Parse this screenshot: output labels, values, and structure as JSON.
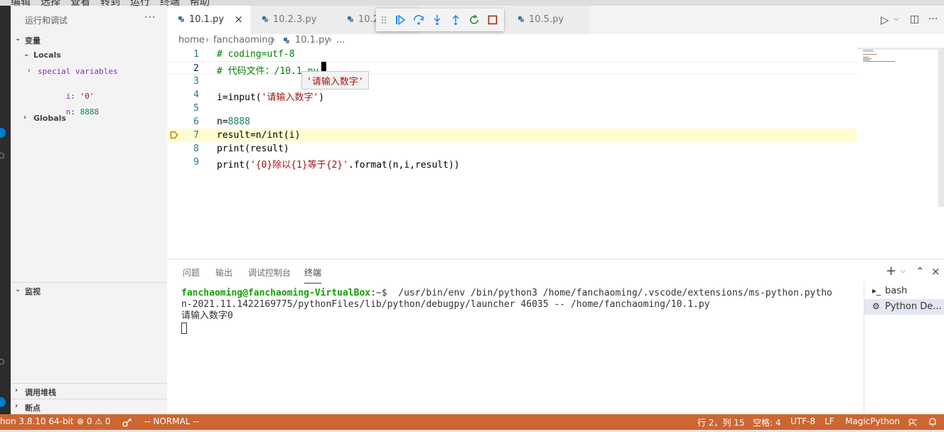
{
  "menubar": {
    "items": [
      "编辑",
      "选择",
      "查看",
      "转到",
      "运行",
      "终端",
      "帮助"
    ]
  },
  "sidebar": {
    "title": "运行和调试",
    "more": "···",
    "variables_label": "变量",
    "locals_label": "Locals",
    "special_variables": "special variables",
    "vars": [
      {
        "name": "i",
        "sep": ": ",
        "value": "'0'"
      },
      {
        "name": "n",
        "sep": ": ",
        "value": "8888"
      }
    ],
    "globals_label": "Globals",
    "watch_label": "监视",
    "callstack_label": "调用堆栈",
    "breakpoints_label": "断点"
  },
  "tabs": [
    {
      "label": "10.1.py",
      "active": true
    },
    {
      "label": "10.2.3.py",
      "active": false
    },
    {
      "label": "10.2",
      "active": false
    },
    {
      "label": "10.5.py",
      "active": false
    }
  ],
  "tab_close": "×",
  "toolbar_right": {
    "run": "▷",
    "run_dropdown": "⌵",
    "split": "◫",
    "more": "···"
  },
  "breadcrumb": {
    "home": "home",
    "sep1": "›",
    "folder": "fanchaoming",
    "sep2": "›",
    "file": "10.1.py",
    "sep3": "›",
    "tail": "..."
  },
  "editor": {
    "lines": [
      {
        "n": "1",
        "parts": [
          {
            "cls": "cmt",
            "t": "# coding=utf-8"
          }
        ]
      },
      {
        "n": "2",
        "parts": [
          {
            "cls": "cmt",
            "t": "# 代码文件：/10.1.py"
          }
        ]
      },
      {
        "n": "3",
        "parts": []
      },
      {
        "n": "4",
        "parts": [
          {
            "cls": "",
            "t": "i=input("
          },
          {
            "cls": "str",
            "t": "'请输入数字'"
          },
          {
            "cls": "",
            "t": ")"
          }
        ]
      },
      {
        "n": "5",
        "parts": []
      },
      {
        "n": "6",
        "parts": [
          {
            "cls": "",
            "t": "n="
          },
          {
            "cls": "num",
            "t": "8888"
          }
        ]
      },
      {
        "n": "7",
        "parts": [
          {
            "cls": "",
            "t": "result=n/int(i)"
          }
        ]
      },
      {
        "n": "8",
        "parts": [
          {
            "cls": "",
            "t": "print(result)"
          }
        ]
      },
      {
        "n": "9",
        "parts": [
          {
            "cls": "",
            "t": "print("
          },
          {
            "cls": "str",
            "t": "'{0}除以{1}等于{2}'"
          },
          {
            "cls": "",
            "t": ".format(n,i,result))"
          }
        ]
      }
    ],
    "current_line": "2",
    "paused_line": "7",
    "hover_text": "'请输入数字'"
  },
  "panel": {
    "tabs": [
      "问题",
      "输出",
      "调试控制台",
      "终端"
    ],
    "active_tab": "终端",
    "actions": {
      "add": "+",
      "dropdown": "⌵",
      "maximize": "⌃",
      "close": "×"
    },
    "terminal": {
      "prompt": "fanchaoming@fanchaoming-VirtualBox",
      "path": ":~$",
      "cmd1": "  /usr/bin/env /bin/python3 /home/fanchaoming/.vscode/extensions/ms-python.pytho",
      "cmd2": "n-2021.11.1422169775/pythonFiles/lib/python/debugpy/launcher 46035 -- /home/fanchaoming/10.1.py",
      "out": "请输入数字0"
    },
    "terminals": [
      {
        "label": "bash",
        "icon": "▸_",
        "selected": false
      },
      {
        "label": "Python De...",
        "icon": "⚙",
        "selected": true
      }
    ]
  },
  "statusbar": {
    "python": "hon 3.8.10 64-bit",
    "errors": "⊗ 0 ⚠ 0",
    "mode": "-- NORMAL --",
    "position": "行 2，列 15",
    "spaces": "空格: 4",
    "encoding": "UTF-8",
    "eol": "LF",
    "language": "MagicPython",
    "color": "#cc6633"
  }
}
